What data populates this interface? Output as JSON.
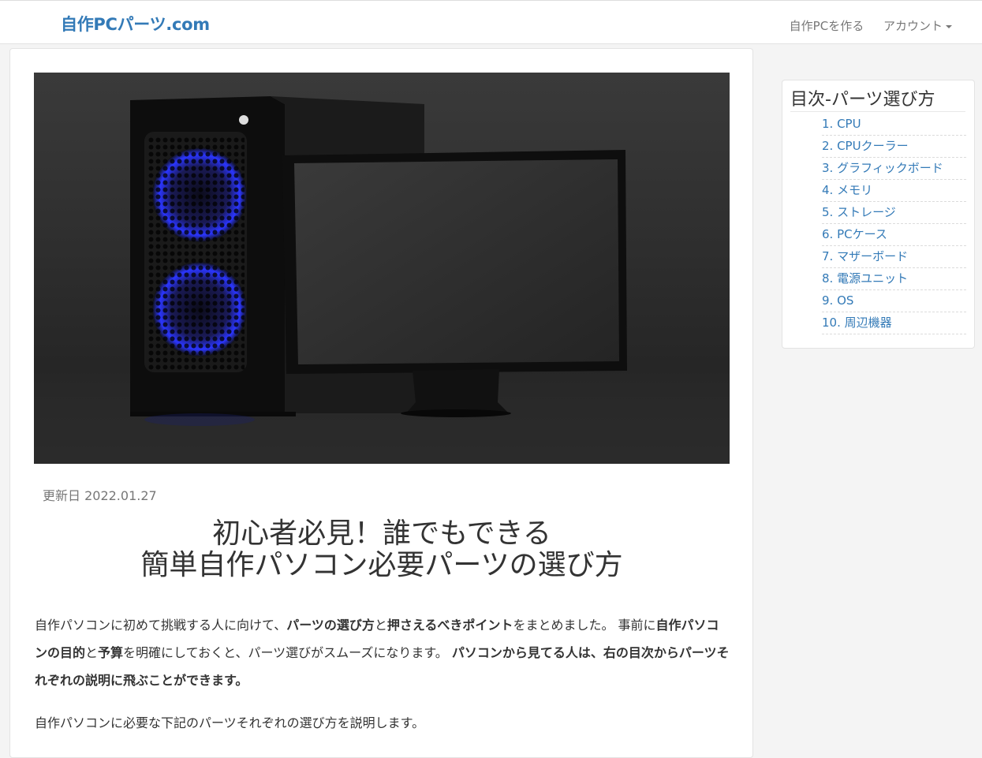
{
  "navbar": {
    "brand": "自作PCパーツ.com",
    "links": {
      "build": "自作PCを作る",
      "account": "アカウント"
    }
  },
  "article": {
    "updated": "更新日 2022.01.27",
    "title_line1": "初心者必見！誰でもできる",
    "title_line2": "簡単自作パソコン必要パーツの選び方",
    "intro": {
      "p1_a": "自作パソコンに初めて挑戦する人に向けて、",
      "p1_b": "パーツの選び方",
      "p1_c": "と",
      "p1_d": "押さえるべきポイント",
      "p1_e": "をまとめました。 事前に",
      "p1_f": "自作パソコンの目的",
      "p1_g": "と",
      "p1_h": "予算",
      "p1_i": "を明確にしておくと、パーツ選びがスムーズになります。",
      "p1_j": "パソコンから見てる人は、右の目次からパーツそれぞれの説明に飛ぶことができます。",
      "p2": "自作パソコンに必要な下記のパーツそれぞれの選び方を説明します。"
    }
  },
  "toc": {
    "title": "目次-パーツ選び方",
    "items": [
      "1. CPU",
      "2. CPUクーラー",
      "3. グラフィックボード",
      "4. メモリ",
      "5. ストレージ",
      "6. PCケース",
      "7. マザーボード",
      "8. 電源ユニット",
      "9. OS",
      "10. 周辺機器"
    ]
  }
}
